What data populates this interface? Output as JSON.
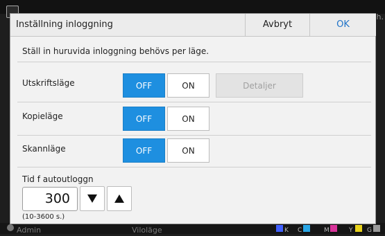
{
  "background": {
    "status_user": "Admin",
    "status_mode": "Viloläge",
    "ink_labels": [
      "K",
      "C",
      "M",
      "Y",
      "G"
    ],
    "ink_colors": [
      "#4060ff",
      "#2aa7e6",
      "#d9339a",
      "#e8d21c",
      "#9a9a9a"
    ],
    "top_right_text": "h."
  },
  "dialog": {
    "title": "Inställning inloggning",
    "cancel_label": "Avbryt",
    "ok_label": "OK",
    "instruction": "Ställ in huruvida inloggning behövs per läge.",
    "rows": [
      {
        "label": "Utskriftsläge",
        "off_label": "OFF",
        "on_label": "ON",
        "selected": "OFF"
      },
      {
        "label": "Kopieläge",
        "off_label": "OFF",
        "on_label": "ON",
        "selected": "OFF"
      },
      {
        "label": "Skannläge",
        "off_label": "OFF",
        "on_label": "ON",
        "selected": "OFF"
      }
    ],
    "details_label": "Detaljer",
    "timeout": {
      "label": "Tid f autoutloggn",
      "value": "300",
      "range_hint": "(10-3600 s.)"
    },
    "accent_color": "#1e8fe0"
  }
}
